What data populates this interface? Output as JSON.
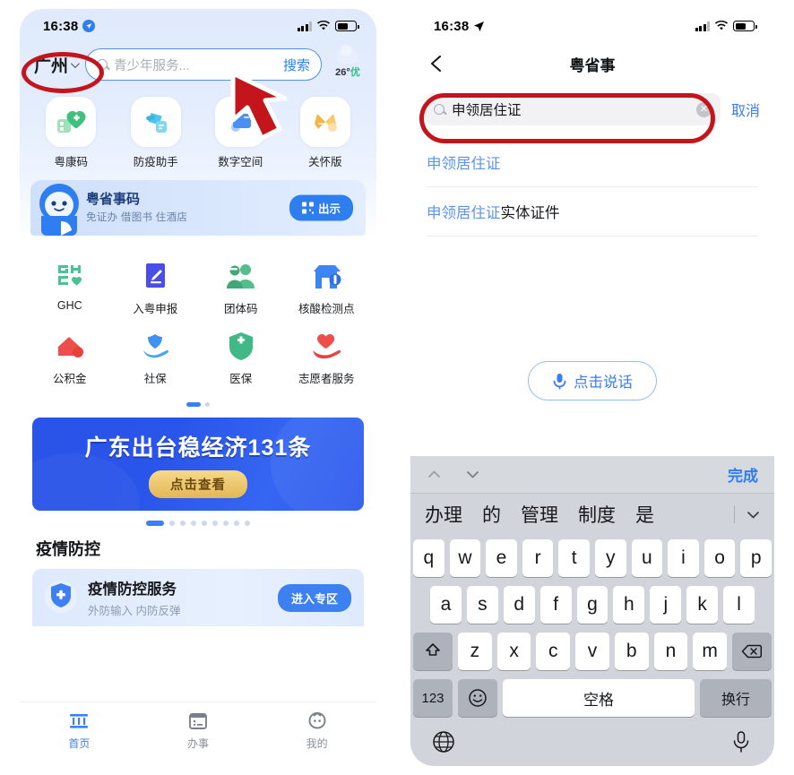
{
  "left_phone": {
    "status_bar": {
      "time": "16:38",
      "location_icon": "location-arrow-icon"
    },
    "header": {
      "city": "广州",
      "search_placeholder": "青少年服务...",
      "search_button": "搜索",
      "weather_temp": "26°",
      "weather_quality": "优"
    },
    "quick_services": [
      {
        "label": "粤康码",
        "icon": "heart-health-code-icon"
      },
      {
        "label": "防疫助手",
        "icon": "spray-disinfect-icon"
      },
      {
        "label": "数字空间",
        "icon": "folder-digital-space-icon"
      },
      {
        "label": "关怀版",
        "icon": "ribbon-care-icon"
      }
    ],
    "mascot_card": {
      "title": "粤省事码",
      "subtitle": "免证办 借图书 住酒店",
      "button": "出示",
      "button_icon": "qr-code-icon"
    },
    "service_grid": [
      {
        "label": "GHC",
        "icon": "ghc-logo-icon"
      },
      {
        "label": "入粤申报",
        "icon": "declaration-pen-icon"
      },
      {
        "label": "团体码",
        "icon": "group-code-icon"
      },
      {
        "label": "核酸检测点",
        "icon": "test-site-icon"
      },
      {
        "label": "公积金",
        "icon": "housing-fund-icon"
      },
      {
        "label": "社保",
        "icon": "social-security-icon"
      },
      {
        "label": "医保",
        "icon": "medical-insurance-icon"
      },
      {
        "label": "志愿者服务",
        "icon": "volunteer-heart-icon"
      }
    ],
    "grid_pages": {
      "total": 2,
      "active": 0
    },
    "banner": {
      "title": "广东出台稳经济131条",
      "button": "点击查看",
      "pages": {
        "total": 9,
        "active": 0
      }
    },
    "section": {
      "title": "疫情防控",
      "card_title": "疫情防控服务",
      "card_subtitle": "外防输入 内防反弹",
      "card_button": "进入专区",
      "card_icon": "shield-plus-icon"
    },
    "tabbar": [
      {
        "label": "首页",
        "icon": "home-bank-icon",
        "active": true
      },
      {
        "label": "办事",
        "icon": "calendar-affairs-icon",
        "active": false
      },
      {
        "label": "我的",
        "icon": "profile-face-icon",
        "active": false
      }
    ]
  },
  "right_phone": {
    "status_bar": {
      "time": "16:38",
      "location_icon": "location-arrow-icon"
    },
    "nav": {
      "back_icon": "chevron-left-icon",
      "title": "粤省事"
    },
    "search": {
      "value": "申领居住证",
      "clear_icon": "clear-circle-icon",
      "search_icon": "search-icon",
      "cancel": "取消"
    },
    "suggestions": [
      {
        "match": "申领居住证",
        "rest": ""
      },
      {
        "match": "申领居住证",
        "rest": "实体证件"
      }
    ],
    "voice_button": {
      "label": "点击说话",
      "icon": "microphone-icon"
    },
    "keyboard": {
      "toolbar": {
        "up_icon": "chevron-up-icon",
        "down_icon": "chevron-down-icon",
        "done": "完成"
      },
      "candidates": [
        "办理",
        "的",
        "管理",
        "制度",
        "是"
      ],
      "candidates_more_icon": "chevron-down-icon",
      "row1": [
        "q",
        "w",
        "e",
        "r",
        "t",
        "y",
        "u",
        "i",
        "o",
        "p"
      ],
      "row2": [
        "a",
        "s",
        "d",
        "f",
        "g",
        "h",
        "j",
        "k",
        "l"
      ],
      "row3": [
        "z",
        "x",
        "c",
        "v",
        "b",
        "n",
        "m"
      ],
      "shift_icon": "shift-icon",
      "backspace_icon": "backspace-icon",
      "numbers_key": "123",
      "emoji_icon": "emoji-icon",
      "space_key": "空格",
      "return_key": "换行",
      "globe_icon": "globe-icon",
      "mic_icon": "microphone-icon"
    }
  },
  "annotations": {
    "city_highlight": "red-ellipse-city",
    "search_highlight": "red-ellipse-search",
    "cursor": "red-arrow-cursor"
  },
  "colors": {
    "accent_blue": "#3d80f1",
    "annotation_red": "#c4151c",
    "banner_blue": "#2a53e8",
    "gold": "#e3b757",
    "green": "#33c08a"
  }
}
